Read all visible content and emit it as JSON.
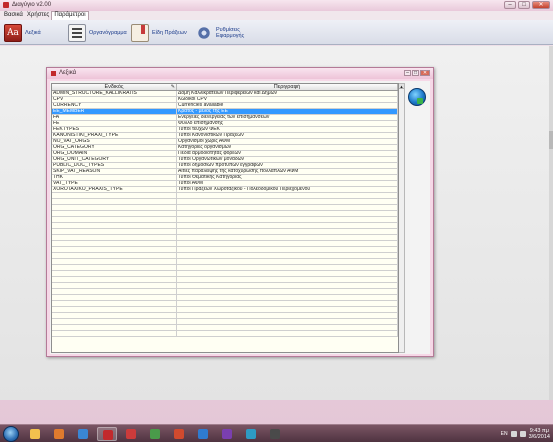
{
  "app": {
    "title": "Διαγύγιο v2.00",
    "window_controls": {
      "minimize": "–",
      "maximize": "□",
      "close": "✕"
    }
  },
  "menu": [
    "Βασικά",
    "Χρήστες",
    "Παράμετροι"
  ],
  "ribbon": {
    "items": [
      {
        "label": "Λεξικά",
        "icon": "dictionary-icon"
      },
      {
        "label": "Οργανόγραμμα",
        "icon": "org-chart-icon"
      },
      {
        "label": "Είδη Πράξεων",
        "icon": "act-types-icon"
      },
      {
        "label": "Ρυθμίσεις\nΕφαρμογής",
        "icon": "settings-gear-icon"
      }
    ]
  },
  "dialog": {
    "title": "Λεξικά",
    "controls": {
      "minimize": "–",
      "maximize": "□",
      "close": "✕"
    },
    "columns": [
      {
        "label": "Ενδικός"
      },
      {
        "label": "Περιγραφή"
      }
    ],
    "rows": [
      {
        "code": "ADMIN_STRUCTURE_KALLIKRATIS",
        "desc": "Δομή Καλλικράτειων Περιφερειών και Δήμων"
      },
      {
        "code": "CPV",
        "desc": "Κωδικοί CPV"
      },
      {
        "code": "CURRENCY",
        "desc": "Currencies available"
      },
      {
        "code": "EE_MEMBER",
        "desc": "Κράτος - μέλος της ΕΕ"
      },
      {
        "code": "FA",
        "desc": "Ενέργειες διενέργειας των επισημάνσεων"
      },
      {
        "code": "FE",
        "desc": "Φύλλο επισήμανσης"
      },
      {
        "code": "FEKTYPES",
        "desc": "Τύποι τευχών ΦΕΚ"
      },
      {
        "code": "KANONISTIKI_PRAXI_TYPE",
        "desc": "Τύποι Κανονιστικών Πράξεων"
      },
      {
        "code": "NO_VAT_ORGS",
        "desc": "Οργανισμοί χωρίς ΑΦΜ"
      },
      {
        "code": "ORG_CATEGORY",
        "desc": "Κατηγορίες οργανισμών"
      },
      {
        "code": "ORG_DOMAIN",
        "desc": "Πεδία αρμοδιότητας φορέων"
      },
      {
        "code": "ORG_UNIT_CATEGORY",
        "desc": "Τύποι Οργανωτικών μονάδων"
      },
      {
        "code": "PUBLIC_DOC_TYPES",
        "desc": "Τύποι δημοσίων πρότυπων εγγράφων"
      },
      {
        "code": "SKIP_VAT_REASON",
        "desc": "Αιτίες παράλειψης της κατοχύρωσης πολλαπλών ΑΦΜ"
      },
      {
        "code": "THK",
        "desc": "Τύποι Θεματικής Κατηγορίας"
      },
      {
        "code": "VAT_TYPE",
        "desc": "Τύποι ΑΦΜ"
      },
      {
        "code": "XOROTAXIKO_PRAXIS_TYPE",
        "desc": "Τύποι Πράξεων Χωροταξικού - Πολεοδομικού Περιεχομένου"
      }
    ],
    "selected_row": 3,
    "empty_rows": 24
  },
  "taskbar": {
    "apps": [
      {
        "name": "explorer",
        "color": "#f2c14e"
      },
      {
        "name": "media-player",
        "color": "#e07b2e"
      },
      {
        "name": "browser",
        "color": "#3a86d4"
      },
      {
        "name": "app-active",
        "color": "#c2292c"
      },
      {
        "name": "app-2",
        "color": "#cc3b3b"
      },
      {
        "name": "app-3",
        "color": "#4a9b4a"
      },
      {
        "name": "app-4",
        "color": "#d14a2e"
      },
      {
        "name": "app-5",
        "color": "#2f7bd0"
      },
      {
        "name": "app-6",
        "color": "#7a3fb0"
      },
      {
        "name": "app-7",
        "color": "#2e9bc4"
      },
      {
        "name": "app-8",
        "color": "#4a4a4a"
      }
    ],
    "language": "EN",
    "time": "9:43 πμ",
    "date": "3/6/2014"
  }
}
